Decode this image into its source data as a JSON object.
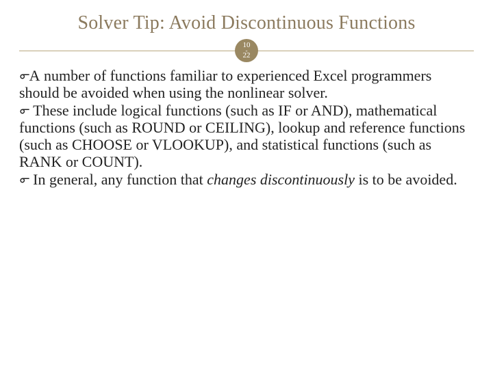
{
  "slide": {
    "title": "Solver Tip: Avoid Discontinuous Functions",
    "badge": {
      "top": "10",
      "dash": "-",
      "bottom": "22"
    },
    "bullet_glyph": "൳",
    "bullets": {
      "b1_lead": "A",
      "b1_rest": " number of functions familiar to experienced Excel programmers should be avoided when using the nonlinear solver.",
      "b2": " These include logical functions (such as IF or AND), mathematical functions (such as ROUND or CEILING), lookup and reference functions (such as CHOOSE or VLOOKUP), and statistical functions (such as RANK or COUNT).",
      "b3_pre": " In general, any function that ",
      "b3_em": "changes discontinuously",
      "b3_post": " is to be avoided."
    }
  }
}
